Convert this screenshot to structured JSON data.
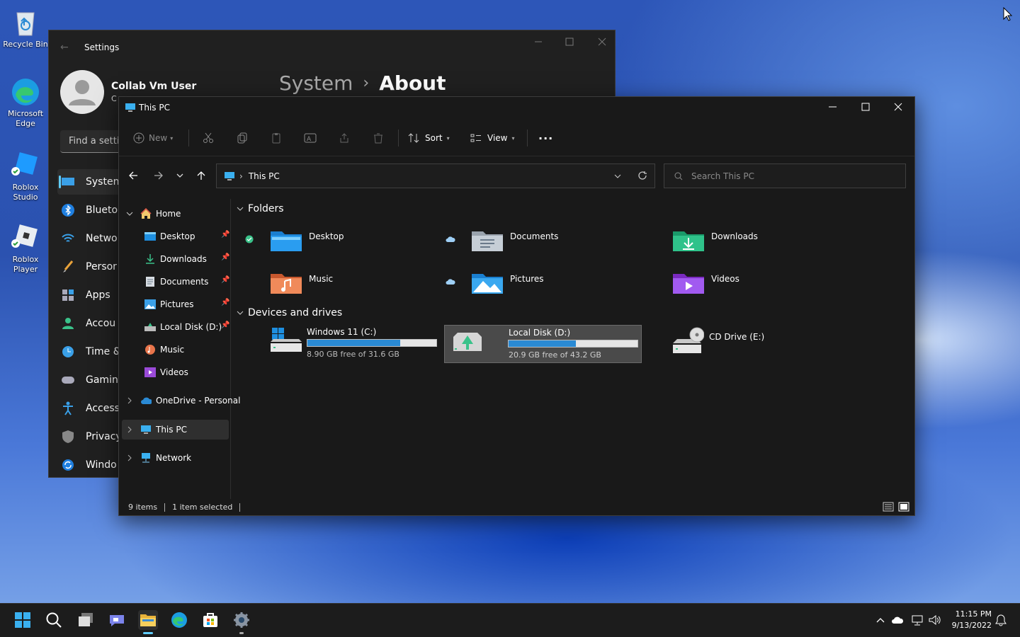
{
  "desktop": {
    "icons": [
      {
        "label": "Recycle Bin"
      },
      {
        "label": "Microsoft Edge"
      },
      {
        "label": "Roblox Studio"
      },
      {
        "label": "Roblox Player"
      }
    ]
  },
  "settings": {
    "title": "Settings",
    "user_name": "Collab Vm User",
    "user_sub": "C",
    "search_placeholder": "Find a settin",
    "breadcrumb_parent": "System",
    "breadcrumb_sep": "›",
    "breadcrumb_current": "About",
    "nav": [
      "Systen",
      "Blueto",
      "Netwo",
      "Persor",
      "Apps",
      "Accou",
      "Time &",
      "Gamin",
      "Access",
      "Privacy",
      "Windo"
    ]
  },
  "explorer": {
    "title": "This PC",
    "toolbar": {
      "new_label": "New",
      "sort_label": "Sort",
      "view_label": "View",
      "more_label": "···"
    },
    "address": {
      "location": "This PC",
      "sep": "›"
    },
    "search": {
      "placeholder": "Search This PC"
    },
    "tree": {
      "home": "Home",
      "quick": [
        {
          "label": "Desktop"
        },
        {
          "label": "Downloads"
        },
        {
          "label": "Documents"
        },
        {
          "label": "Pictures"
        },
        {
          "label": "Local Disk (D:)"
        },
        {
          "label": "Music"
        },
        {
          "label": "Videos"
        }
      ],
      "onedrive": "OneDrive - Personal",
      "thispc": "This PC",
      "network": "Network"
    },
    "sections": {
      "folders": "Folders",
      "devices": "Devices and drives"
    },
    "folders": [
      {
        "label": "Desktop"
      },
      {
        "label": "Documents"
      },
      {
        "label": "Downloads"
      },
      {
        "label": "Music"
      },
      {
        "label": "Pictures"
      },
      {
        "label": "Videos"
      }
    ],
    "drives": [
      {
        "label": "Windows 11 (C:)",
        "free": "8.90 GB free of 31.6 GB",
        "used_fraction": 0.72
      },
      {
        "label": "Local Disk (D:)",
        "free": "20.9 GB free of 43.2 GB",
        "used_fraction": 0.52,
        "selected": true
      },
      {
        "label": "CD Drive (E:)"
      }
    ],
    "status": {
      "items": "9 items",
      "selected": "1 item selected"
    }
  },
  "taskbar": {
    "time": "11:15 PM",
    "date": "9/13/2022"
  },
  "colors": {
    "accent": "#2a8ad4",
    "window_bg": "#191919",
    "settings_bg": "#202020"
  }
}
